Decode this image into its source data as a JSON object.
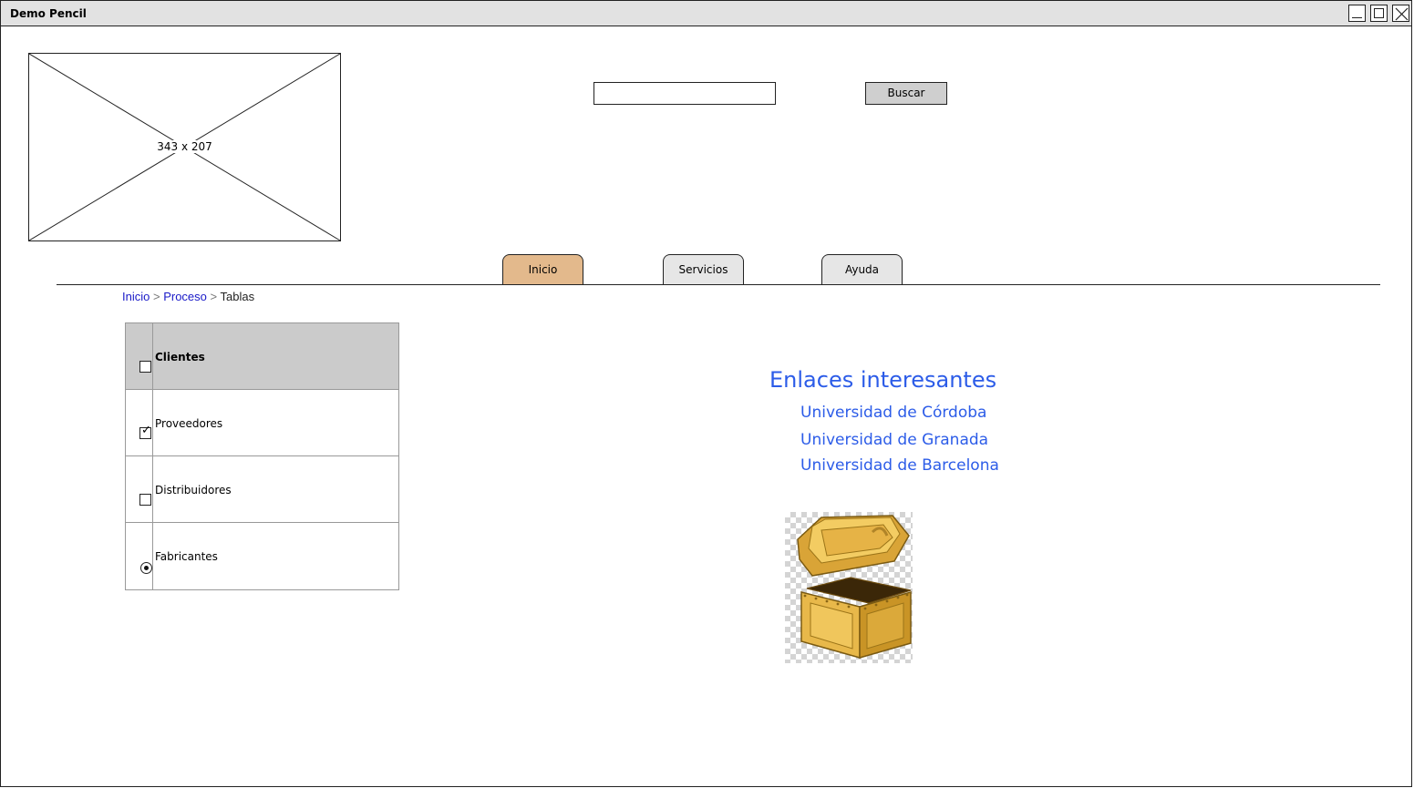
{
  "window": {
    "title": "Demo Pencil",
    "controls": {
      "minimize": "minimize-icon",
      "maximize": "maximize-icon",
      "close": "close-icon"
    }
  },
  "header": {
    "image_placeholder_label": "343 x 207",
    "search": {
      "value": "",
      "placeholder": "",
      "button_label": "Buscar"
    }
  },
  "tabs": [
    {
      "label": "Inicio",
      "active": true
    },
    {
      "label": "Servicios",
      "active": false
    },
    {
      "label": "Ayuda",
      "active": false
    }
  ],
  "breadcrumb": {
    "items": [
      {
        "label": "Inicio",
        "link": true
      },
      {
        "label": "Proceso",
        "link": true
      },
      {
        "label": "Tablas",
        "link": false
      }
    ],
    "separator": ">"
  },
  "list": {
    "rows": [
      {
        "label": "Clientes",
        "control": "checkbox",
        "checked": false,
        "header": true
      },
      {
        "label": "Proveedores",
        "control": "checkbox",
        "checked": true,
        "header": false
      },
      {
        "label": "Distribuidores",
        "control": "checkbox",
        "checked": false,
        "header": false
      },
      {
        "label": "Fabricantes",
        "control": "radio",
        "checked": true,
        "header": false
      }
    ]
  },
  "links": {
    "title": "Enlaces interesantes",
    "items": [
      "Universidad de Córdoba",
      "Universidad de Granada",
      "Universidad de Barcelona"
    ]
  },
  "image": {
    "icon": "treasure-chest-icon"
  },
  "colors": {
    "active_tab": "#e3b98c",
    "link_blue": "#2c5ce8",
    "breadcrumb_link": "#1a1ac8",
    "list_header_bg": "#cbcbcb"
  }
}
